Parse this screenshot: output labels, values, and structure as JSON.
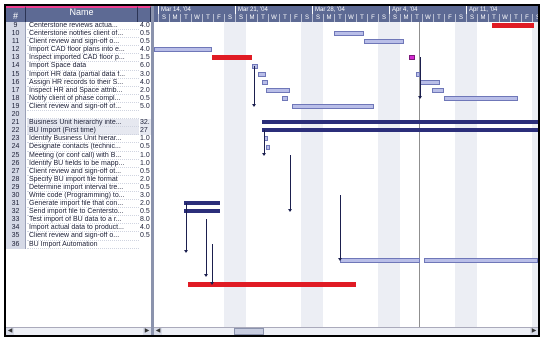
{
  "grid": {
    "headers": {
      "num": "#",
      "name": "Name",
      "dur": ""
    },
    "rows": [
      {
        "num": "9",
        "name": "Centerstone reviews actua...",
        "dur": "4.0"
      },
      {
        "num": "10",
        "name": "Centerstone notifies client of...",
        "dur": "0.5"
      },
      {
        "num": "11",
        "name": "Client review and sign-off o...",
        "dur": "0.5"
      },
      {
        "num": "12",
        "name": "Import CAD floor plans into e...",
        "dur": "4.0"
      },
      {
        "num": "13",
        "name": "Inspect imported CAD floor p...",
        "dur": "1.5"
      },
      {
        "num": "14",
        "name": "Import Space data",
        "dur": "6.0"
      },
      {
        "num": "15",
        "name": "Import HR data (partial data f...",
        "dur": "3.0"
      },
      {
        "num": "16",
        "name": "Assign HR records to their S...",
        "dur": "4.0"
      },
      {
        "num": "17",
        "name": "Inspect HR and Space attrib...",
        "dur": "2.0"
      },
      {
        "num": "18",
        "name": "Notify client of phase compl...",
        "dur": "0.5"
      },
      {
        "num": "19",
        "name": "Client review and sign-off of...",
        "dur": "5.0"
      },
      {
        "num": "20",
        "name": "",
        "dur": ""
      },
      {
        "num": "21",
        "name": "Business Unit hierarchy inte...",
        "dur": "32."
      },
      {
        "num": "22",
        "name": "BU Import (First time)",
        "dur": "27"
      },
      {
        "num": "23",
        "name": "Identify Business Unit hierar...",
        "dur": "1.0"
      },
      {
        "num": "24",
        "name": "Designate contacts (technic...",
        "dur": "0.5"
      },
      {
        "num": "25",
        "name": "Meeting (or conf call) with B...",
        "dur": "1.0"
      },
      {
        "num": "26",
        "name": "Identify BU fields to be mapp...",
        "dur": "1.0"
      },
      {
        "num": "27",
        "name": "Client review and sign-off ot...",
        "dur": "0.5"
      },
      {
        "num": "28",
        "name": "Specify BU import file format",
        "dur": "2.0"
      },
      {
        "num": "29",
        "name": "Determine import interval tre...",
        "dur": "0.5"
      },
      {
        "num": "30",
        "name": "Write code (Programming) to...",
        "dur": "3.0"
      },
      {
        "num": "31",
        "name": "Generate import file that con...",
        "dur": "2.0"
      },
      {
        "num": "32",
        "name": "Send import file to Centersto...",
        "dur": "0.5"
      },
      {
        "num": "33",
        "name": "Test import of BU data to a r...",
        "dur": "8.0"
      },
      {
        "num": "34",
        "name": "Import actual data to product...",
        "dur": "4.0"
      },
      {
        "num": "35",
        "name": "Client review and sign-off o...",
        "dur": "0.5"
      },
      {
        "num": "36",
        "name": "BU Import Automation",
        "dur": ""
      }
    ]
  },
  "timeline": {
    "weeks": [
      "Mar 14, '04",
      "Mar 21, '04",
      "Mar 28, '04",
      "Apr 4, '04",
      "Apr 11, '04"
    ],
    "day_letters": [
      "S",
      "M",
      "T",
      "W",
      "T",
      "F",
      "S"
    ]
  },
  "colors": {
    "header_bg": "#5d6a94",
    "task_bar": "#b9bee8",
    "critical_bar": "#e01b24",
    "summary_bar": "#2b2e7a",
    "milestone": "#d62ad2"
  },
  "scrollbars": {
    "left_arrow": "◀",
    "right_arrow": "▶",
    "up_arrow": "▲",
    "down_arrow": "▼"
  }
}
